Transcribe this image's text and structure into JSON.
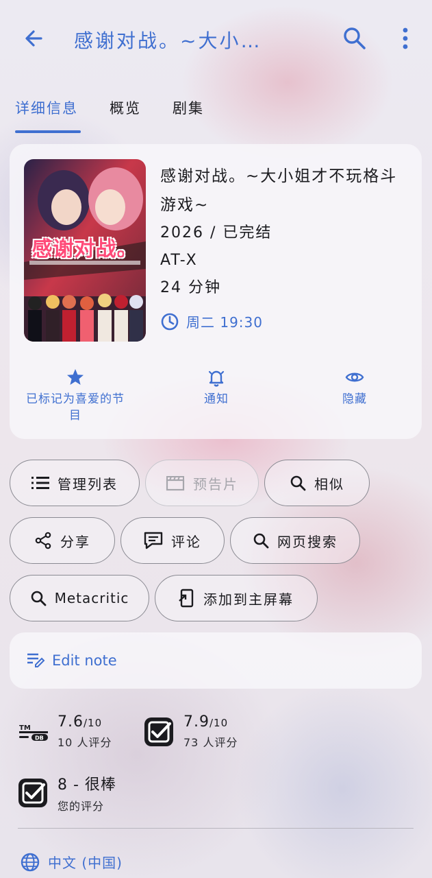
{
  "app_bar": {
    "title": "感谢对战。~大小…",
    "back_icon": "arrow-back-icon",
    "search_icon": "search-icon",
    "more_icon": "more-vert-icon"
  },
  "tabs": [
    {
      "label": "详细信息",
      "active": true
    },
    {
      "label": "概览",
      "active": false
    },
    {
      "label": "剧集",
      "active": false
    }
  ],
  "show": {
    "title": "感谢对战。~大小姐才不玩格斗游戏~",
    "year_status": "2026 / 已完结",
    "network": "AT-X",
    "runtime": "24 分钟",
    "airing": "周二 19:30",
    "poster_text": "感谢对战。"
  },
  "actions": [
    {
      "label": "已标记为喜爱的节目",
      "icon": "star-icon"
    },
    {
      "label": "通知",
      "icon": "bell-icon"
    },
    {
      "label": "隐藏",
      "icon": "eye-icon"
    }
  ],
  "chips": {
    "manage_list": "管理列表",
    "trailer": "预告片",
    "similar": "相似",
    "share": "分享",
    "comments": "评论",
    "web_search": "网页搜索",
    "metacritic": "Metacritic",
    "add_home": "添加到主屏幕"
  },
  "note": {
    "label": "Edit note"
  },
  "ratings": {
    "tmdb": {
      "score": "7.6",
      "max": "/10",
      "votes": "10 人评分",
      "logo": "TMDB"
    },
    "trakt": {
      "score": "7.9",
      "max": "/10",
      "votes": "73 人评分"
    },
    "user": {
      "score": "8 - 很棒",
      "label": "您的评分"
    }
  },
  "language": {
    "label": "中文 (中国)"
  },
  "colors": {
    "accent": "#3f6fd0",
    "text": "#1b1b1f"
  }
}
